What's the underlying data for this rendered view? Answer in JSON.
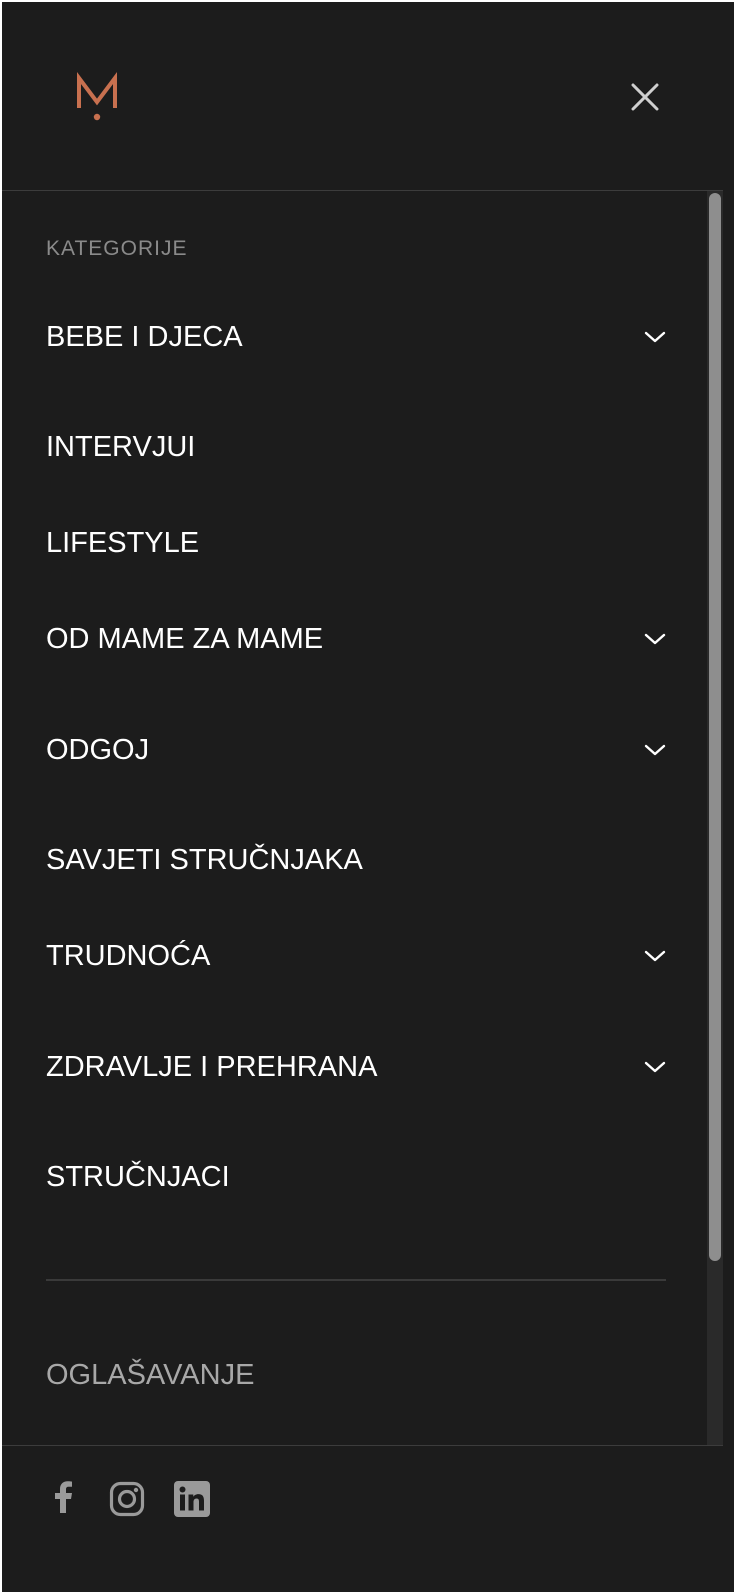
{
  "header": {
    "logo_icon": "m-logo-icon",
    "close_icon": "close-icon",
    "accent_color": "#c8704f"
  },
  "menu": {
    "section_label": "KATEGORIJE",
    "items": [
      {
        "label": "BEBE I DJECA",
        "expandable": true
      },
      {
        "label": "INTERVJUI",
        "expandable": false
      },
      {
        "label": "LIFESTYLE",
        "expandable": false
      },
      {
        "label": "OD MAME ZA MAME",
        "expandable": true
      },
      {
        "label": "ODGOJ",
        "expandable": true
      },
      {
        "label": "SAVJETI STRUČNJAKA",
        "expandable": false
      },
      {
        "label": "TRUDNOĆA",
        "expandable": true
      },
      {
        "label": "ZDRAVLJE I PREHRANA",
        "expandable": true
      },
      {
        "label": "STRUČNJACI",
        "expandable": false
      }
    ],
    "secondary_link": "OGLAŠAVANJE"
  },
  "footer": {
    "social_icons": [
      "facebook-icon",
      "instagram-icon",
      "linkedin-icon"
    ]
  }
}
